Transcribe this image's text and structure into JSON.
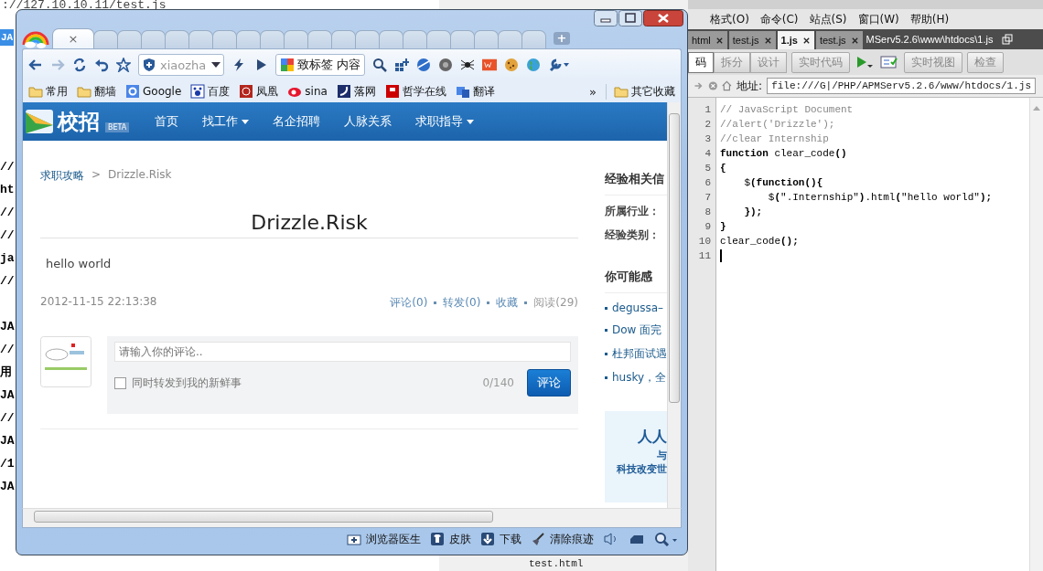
{
  "text_window": {
    "url": "://127.10.10.11/test.js",
    "selected_line": "JA",
    "fragments_upper": [
      "//",
      "ht",
      "//",
      "//",
      "ja",
      "//"
    ],
    "fragments_lower": [
      "JA",
      "//",
      "用",
      "JA",
      "//",
      "JA",
      "/1",
      "JA"
    ]
  },
  "editor": {
    "menu": [
      "格式(O)",
      "命令(C)",
      "站点(S)",
      "窗口(W)",
      "帮助(H)"
    ],
    "tabs": [
      {
        "label": "html",
        "selected": false
      },
      {
        "label": "test.js",
        "selected": false
      },
      {
        "label": "1.js",
        "selected": true
      },
      {
        "label": "test.js",
        "selected": false
      }
    ],
    "path": "MServ5.2.6\\www\\htdocs\\1.js",
    "view_buttons": [
      {
        "label": "码",
        "selected": true
      },
      {
        "label": "拆分",
        "selected": false
      },
      {
        "label": "设计",
        "selected": false
      }
    ],
    "live_code": "实时代码",
    "live_view": "实时视图",
    "inspect": "检查",
    "address_label": "地址:",
    "address": "file:///G|/PHP/APMServ5.2.6/www/htdocs/1.js",
    "code": [
      {
        "number": "1",
        "segments": [
          {
            "kind": "comment",
            "text": "// JavaScript Document"
          }
        ]
      },
      {
        "number": "2",
        "segments": [
          {
            "kind": "comment",
            "text": "//alert('Drizzle');"
          }
        ]
      },
      {
        "number": "3",
        "segments": [
          {
            "kind": "comment",
            "text": "//clear Internship"
          }
        ]
      },
      {
        "number": "4",
        "segments": [
          {
            "kind": "keyword",
            "text": "function"
          },
          {
            "kind": "plain",
            "text": " clear_code"
          },
          {
            "kind": "keyword",
            "text": "()"
          }
        ]
      },
      {
        "number": "5",
        "segments": [
          {
            "kind": "keyword",
            "text": "{"
          }
        ]
      },
      {
        "number": "6",
        "segments": [
          {
            "kind": "plain",
            "text": "    $"
          },
          {
            "kind": "keyword",
            "text": "(function(){"
          }
        ]
      },
      {
        "number": "7",
        "segments": [
          {
            "kind": "plain",
            "text": "        $"
          },
          {
            "kind": "keyword",
            "text": "("
          },
          {
            "kind": "plain",
            "text": "\".Internship\""
          },
          {
            "kind": "keyword",
            "text": ")"
          },
          {
            "kind": "plain",
            "text": ".html"
          },
          {
            "kind": "keyword",
            "text": "("
          },
          {
            "kind": "plain",
            "text": "\"hello world\""
          },
          {
            "kind": "keyword",
            "text": ");"
          }
        ]
      },
      {
        "number": "8",
        "segments": [
          {
            "kind": "keyword",
            "text": "    });"
          }
        ]
      },
      {
        "number": "9",
        "segments": [
          {
            "kind": "keyword",
            "text": "}"
          }
        ]
      },
      {
        "number": "10",
        "segments": [
          {
            "kind": "plain",
            "text": "clear_code"
          },
          {
            "kind": "keyword",
            "text": "();"
          }
        ]
      },
      {
        "number": "11"
      }
    ],
    "file_tree": [
      "test.html"
    ]
  },
  "browser": {
    "tab_close": "×",
    "new_tab": "+",
    "omnibox": "xiaozha",
    "search_box": "致标签 内容",
    "bookmarks": [
      {
        "label": "常用",
        "kind": "folder"
      },
      {
        "label": "翻墙",
        "kind": "folder"
      },
      {
        "label": "Google",
        "kind": "google"
      },
      {
        "label": "百度",
        "kind": "baidu"
      },
      {
        "label": "凤凰",
        "kind": "ifeng"
      },
      {
        "label": "sina",
        "kind": "weibo"
      },
      {
        "label": "落网",
        "kind": "luo"
      },
      {
        "label": "哲学在线",
        "kind": "p"
      },
      {
        "label": "翻译",
        "kind": "translate"
      }
    ],
    "bookmarks_more": "»",
    "other_bookmarks": "其它收藏",
    "status_items": [
      {
        "label": "浏览器医生",
        "kind": "doctor"
      },
      {
        "label": "皮肤",
        "kind": "skin"
      },
      {
        "label": "下载",
        "kind": "download"
      },
      {
        "label": "清除痕迹",
        "kind": "clean"
      }
    ]
  },
  "page": {
    "logo": "校招",
    "badge": "BETA",
    "nav": [
      {
        "label": "首页",
        "dropdown": false
      },
      {
        "label": "找工作",
        "dropdown": true
      },
      {
        "label": "名企招聘",
        "dropdown": false
      },
      {
        "label": "人脉关系",
        "dropdown": false
      },
      {
        "label": "求职指导",
        "dropdown": true
      }
    ],
    "breadcrumb": {
      "parent": "求职攻略",
      "separator": ">",
      "current": "Drizzle.Risk"
    },
    "title": "Drizzle.Risk",
    "body": "hello world",
    "date": "2012-11-15 22:13:38",
    "actions": [
      "评论(0)",
      "转发(0)",
      "收藏",
      "阅读(29)"
    ],
    "comment": {
      "placeholder": "请输入你的评论..",
      "share_label": "同时转发到我的新鲜事",
      "share_checked": false,
      "counter": "0/140",
      "submit": "评论"
    },
    "sidebar": {
      "heading_1": "经验相关信",
      "fields": [
        "所属行业：",
        "经验类别："
      ],
      "heading_2": "你可能感",
      "links": [
        "degussa–",
        "Dow 面完",
        "杜邦面试遇",
        "husky，全"
      ],
      "ad": [
        "人人",
        "与",
        "科技改变世"
      ]
    }
  }
}
